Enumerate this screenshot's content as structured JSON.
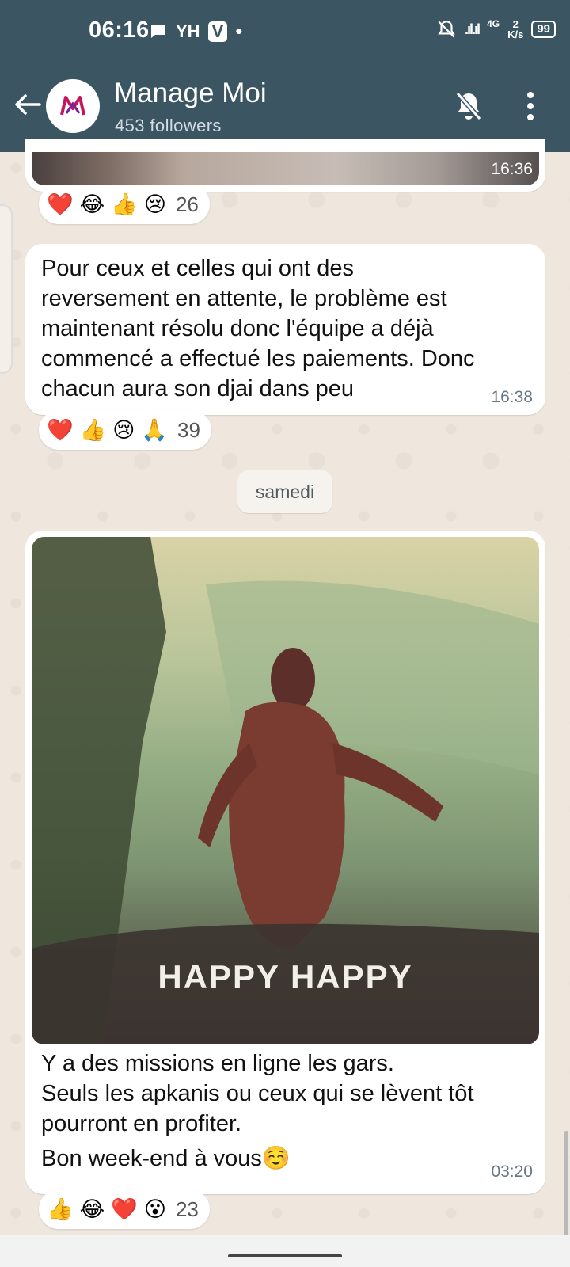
{
  "status_bar": {
    "time": "06:16",
    "left_icons": [
      "chat-icon",
      "bluetooth-audio-icon",
      "app-icon",
      "dot-icon"
    ],
    "carrier_box": "V",
    "hd_label": "YH",
    "net_type": "4G",
    "net_speed_value": "2",
    "net_speed_unit": "K/s",
    "battery": "99"
  },
  "header": {
    "title": "Manage Moi",
    "subtitle": "453 followers"
  },
  "messages": [
    {
      "type": "image-partial",
      "time": "16:36",
      "reactions": [
        "❤️",
        "😂",
        "👍",
        "😢"
      ],
      "reaction_count": "26"
    },
    {
      "type": "text",
      "lines": [
        "Pour ceux et celles qui ont des",
        "reversement en attente, le problème est",
        "maintenant résolu donc l'équipe a déjà",
        "commencé a effectué les paiements. Donc",
        "chacun aura son djai dans peu"
      ],
      "time": "16:38",
      "reactions": [
        "❤️",
        "👍",
        "😢",
        "🙏"
      ],
      "reaction_count": "39"
    },
    {
      "type": "image",
      "image_caption": "HAPPY HAPPY",
      "lines": [
        "Y a des missions en ligne les gars.",
        "Seuls les apkanis ou ceux qui se lèvent tôt",
        "pourront en profiter.",
        "Bon week-end à vous☺️"
      ],
      "time": "03:20",
      "reactions": [
        "👍",
        "😂",
        "❤️",
        "😮"
      ],
      "reaction_count": "23"
    }
  ],
  "date_separator": "samedi"
}
